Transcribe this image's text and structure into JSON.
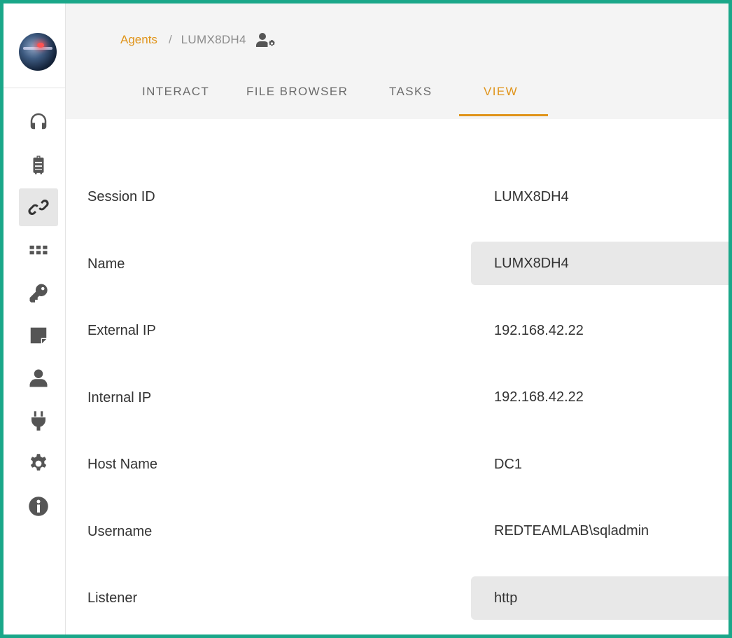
{
  "breadcrumb": {
    "parent": "Agents",
    "separator": "/",
    "current": "LUMX8DH4",
    "icon": "user-gear-icon"
  },
  "tabs": [
    {
      "label": "INTERACT",
      "active": false
    },
    {
      "label": "FILE BROWSER",
      "active": false
    },
    {
      "label": "TASKS",
      "active": false
    },
    {
      "label": "VIEW",
      "active": true
    }
  ],
  "sidebar": {
    "logo": "planet-logo",
    "items": [
      {
        "icon": "headphones-icon",
        "active": false
      },
      {
        "icon": "suitcase-icon",
        "active": false
      },
      {
        "icon": "link-icon",
        "active": true
      },
      {
        "icon": "grid-icon",
        "active": false
      },
      {
        "icon": "key-icon",
        "active": false
      },
      {
        "icon": "sticky-note-icon",
        "active": false
      },
      {
        "icon": "user-icon",
        "active": false
      },
      {
        "icon": "plug-icon",
        "active": false
      },
      {
        "icon": "gear-icon",
        "active": false
      },
      {
        "icon": "info-icon",
        "active": false
      }
    ]
  },
  "details": [
    {
      "label": "Session ID",
      "value": "LUMX8DH4",
      "editable": false
    },
    {
      "label": "Name",
      "value": "LUMX8DH4",
      "editable": true
    },
    {
      "label": "External IP",
      "value": "192.168.42.22",
      "editable": false
    },
    {
      "label": "Internal IP",
      "value": "192.168.42.22",
      "editable": false
    },
    {
      "label": "Host Name",
      "value": "DC1",
      "editable": false
    },
    {
      "label": "Username",
      "value": "REDTEAMLAB\\sqladmin",
      "editable": false
    },
    {
      "label": "Listener",
      "value": "http",
      "editable": true
    }
  ],
  "colors": {
    "accent": "#e0941a",
    "frame_border": "#1aa789",
    "header_bg": "#f4f4f4",
    "input_bg": "#e8e8e8",
    "icon": "#555555"
  }
}
